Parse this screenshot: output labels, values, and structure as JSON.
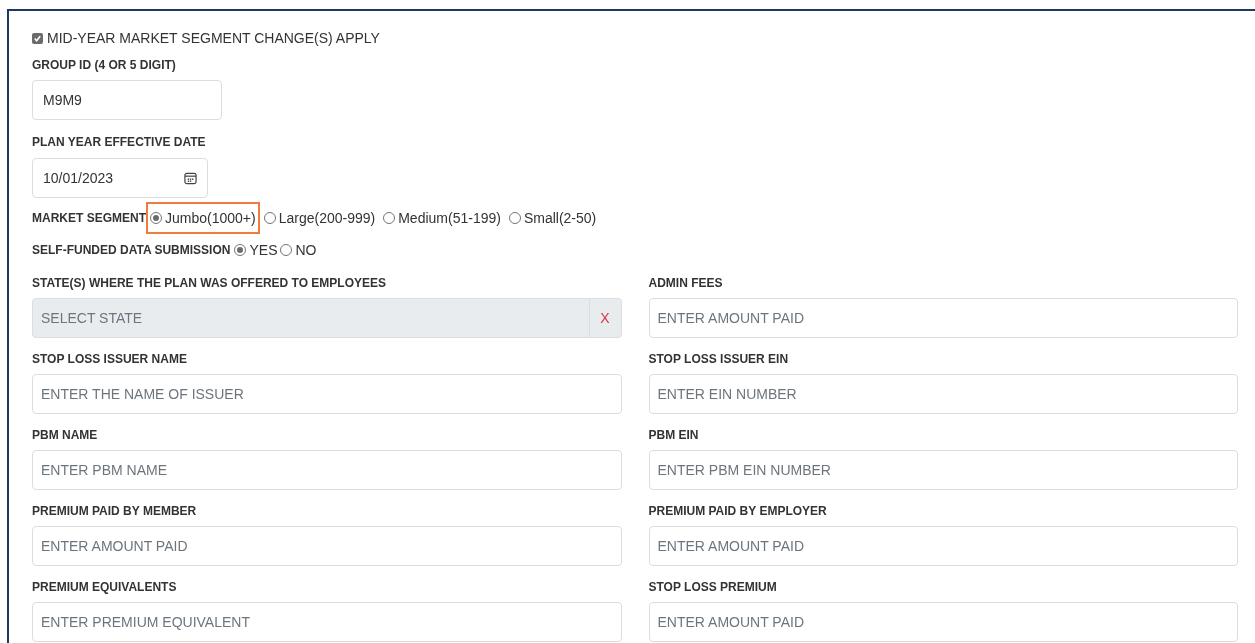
{
  "mid_year": {
    "label": "MID-YEAR MARKET SEGMENT CHANGE(S) APPLY",
    "checked": true
  },
  "group_id": {
    "label": "GROUP ID (4 OR 5 DIGIT)",
    "value": "M9M9"
  },
  "plan_year_date": {
    "label": "PLAN YEAR EFFECTIVE DATE",
    "value": "10/01/2023"
  },
  "market_segment": {
    "label": "MARKET SEGMENT",
    "options": [
      {
        "label": "Jumbo(1000+)",
        "selected": true,
        "highlighted": true
      },
      {
        "label": "Large(200-999)",
        "selected": false,
        "highlighted": false
      },
      {
        "label": "Medium(51-199)",
        "selected": false,
        "highlighted": false
      },
      {
        "label": "Small(2-50)",
        "selected": false,
        "highlighted": false
      }
    ]
  },
  "self_funded": {
    "label": "SELF-FUNDED DATA SUBMISSION",
    "options": [
      {
        "label": "YES",
        "selected": true
      },
      {
        "label": "NO",
        "selected": false
      }
    ]
  },
  "fields": [
    {
      "kind": "select",
      "label": "STATE(S) WHERE THE PLAN WAS OFFERED TO EMPLOYEES",
      "placeholder": "SELECT STATE",
      "clear": "X"
    },
    {
      "kind": "text",
      "label": "ADMIN FEES",
      "placeholder": "ENTER AMOUNT PAID"
    },
    {
      "kind": "text",
      "label": "STOP LOSS ISSUER NAME",
      "placeholder": "ENTER THE NAME OF ISSUER"
    },
    {
      "kind": "text",
      "label": "STOP LOSS ISSUER EIN",
      "placeholder": "ENTER EIN NUMBER"
    },
    {
      "kind": "text",
      "label": "PBM NAME",
      "placeholder": "ENTER PBM NAME"
    },
    {
      "kind": "text",
      "label": "PBM EIN",
      "placeholder": "ENTER PBM EIN NUMBER"
    },
    {
      "kind": "text",
      "label": "PREMIUM PAID BY MEMBER",
      "placeholder": "ENTER AMOUNT PAID"
    },
    {
      "kind": "text",
      "label": "PREMIUM PAID BY EMPLOYER",
      "placeholder": "ENTER AMOUNT PAID"
    },
    {
      "kind": "text",
      "label": "PREMIUM EQUIVALENTS",
      "placeholder": "ENTER PREMIUM EQUIVALENT"
    },
    {
      "kind": "text",
      "label": "STOP LOSS PREMIUM",
      "placeholder": "ENTER AMOUNT PAID"
    }
  ]
}
